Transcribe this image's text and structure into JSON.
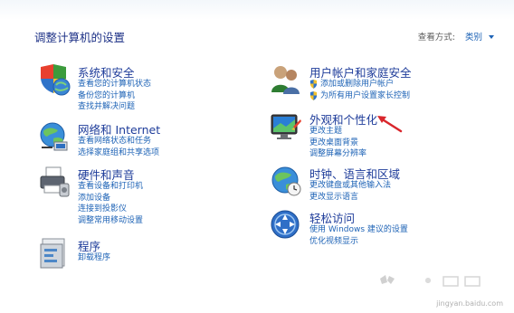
{
  "page": {
    "title": "调整计算机的设置",
    "view_by_label": "查看方式:",
    "view_by_value": "类别"
  },
  "categories": {
    "system": {
      "title": "系统和安全",
      "icon": "shield-globe-icon",
      "links": [
        "查看您的计算机状态",
        "备份您的计算机",
        "查找并解决问题"
      ]
    },
    "network": {
      "title": "网络和 Internet",
      "icon": "network-globe-icon",
      "links": [
        "查看网络状态和任务",
        "选择家庭组和共享选项"
      ]
    },
    "hardware": {
      "title": "硬件和声音",
      "icon": "printer-icon",
      "links": [
        "查看设备和打印机",
        "添加设备",
        "连接到投影仪",
        "调整常用移动设置"
      ]
    },
    "programs": {
      "title": "程序",
      "icon": "programs-icon",
      "links": [
        "卸载程序"
      ]
    },
    "accounts": {
      "title": "用户帐户和家庭安全",
      "icon": "users-icon",
      "links": [
        "添加或删除用户帐户",
        "为所有用户设置家长控制"
      ]
    },
    "appearance": {
      "title": "外观和个性化",
      "icon": "monitor-paint-icon",
      "links": [
        "更改主题",
        "更改桌面背景",
        "调整屏幕分辨率"
      ]
    },
    "clock": {
      "title": "时钟、语言和区域",
      "icon": "clock-globe-icon",
      "links": [
        "更改键盘或其他输入法",
        "更改显示语言"
      ]
    },
    "ease": {
      "title": "轻松访问",
      "icon": "ease-of-access-icon",
      "links": [
        "使用 Windows 建议的设置",
        "优化视频显示"
      ]
    }
  },
  "watermark": {
    "text": "jingyan.baidu.com"
  },
  "colors": {
    "title": "#1e3c9a",
    "link": "#1e63b6",
    "arrow": "#d9262c"
  }
}
